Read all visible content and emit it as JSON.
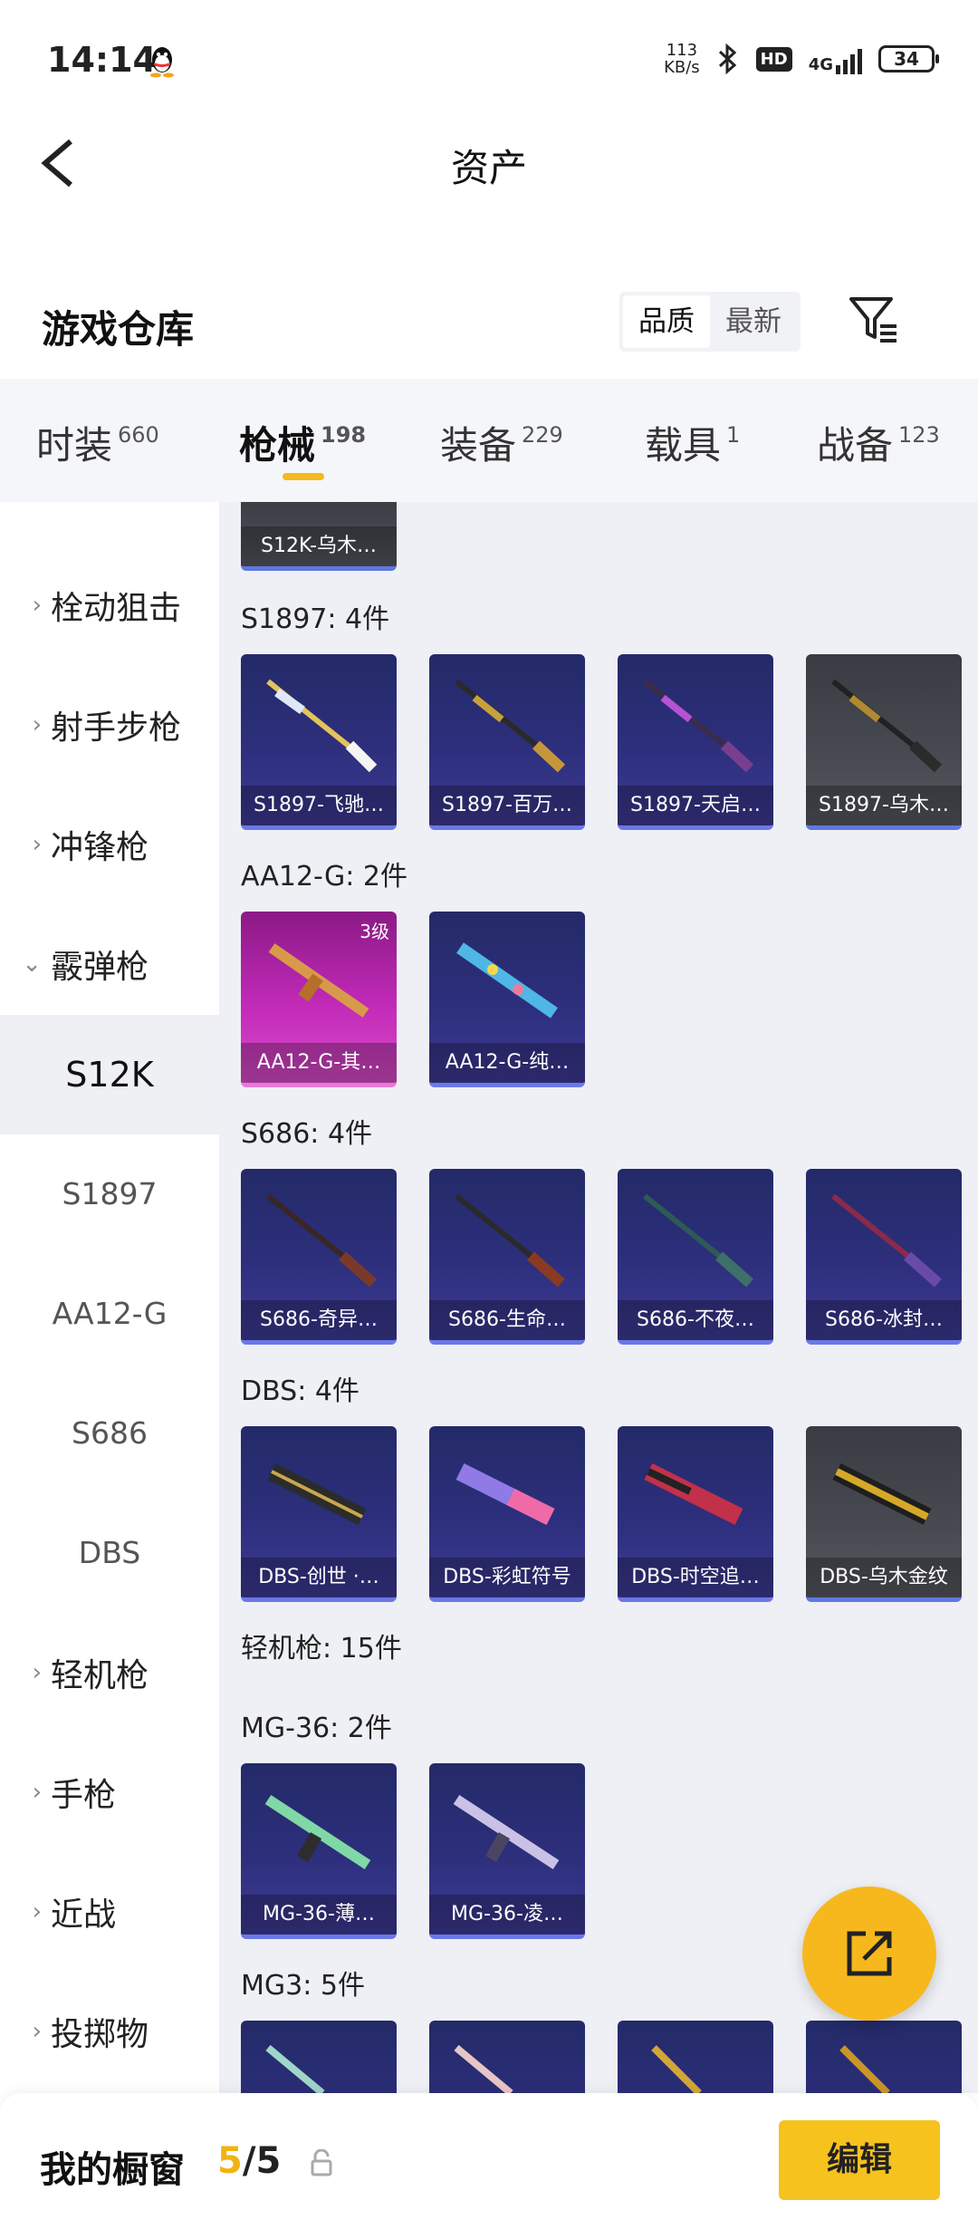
{
  "status": {
    "time": "14:14",
    "net_speed_value": "113",
    "net_speed_unit": "KB/s",
    "hd": "HD",
    "network": "4G",
    "battery": "34"
  },
  "header": {
    "title": "资产"
  },
  "warehouse": {
    "title": "游戏仓库",
    "sort_options": [
      "品质",
      "最新"
    ],
    "sort_active": "品质"
  },
  "tabs": [
    {
      "label": "时装",
      "count": "660"
    },
    {
      "label": "枪械",
      "count": "198"
    },
    {
      "label": "装备",
      "count": "229"
    },
    {
      "label": "载具",
      "count": "1"
    },
    {
      "label": "战备",
      "count": "123"
    }
  ],
  "sidebar": {
    "categories": [
      {
        "label": "栓动狙击",
        "expanded": false
      },
      {
        "label": "射手步枪",
        "expanded": false
      },
      {
        "label": "冲锋枪",
        "expanded": false
      },
      {
        "label": "霰弹枪",
        "expanded": true
      }
    ],
    "subitems": [
      "S12K",
      "S1897",
      "AA12-G",
      "S686",
      "DBS"
    ],
    "active_subitem": "S12K",
    "more_categories": [
      {
        "label": "轻机枪"
      },
      {
        "label": "手枪"
      },
      {
        "label": "近战"
      },
      {
        "label": "投掷物"
      }
    ]
  },
  "content": {
    "top_partial_card": {
      "label": "S12K-乌木…",
      "style": "grey"
    },
    "sections": [
      {
        "title": "S1897: 4件",
        "items": [
          {
            "label": "S1897-飞驰…",
            "style": "blue"
          },
          {
            "label": "S1897-百万…",
            "style": "blue"
          },
          {
            "label": "S1897-天启…",
            "style": "blue"
          },
          {
            "label": "S1897-乌木…",
            "style": "grey"
          }
        ]
      },
      {
        "title": "AA12-G: 2件",
        "items": [
          {
            "label": "AA12-G-其…",
            "style": "pink",
            "level": "3级"
          },
          {
            "label": "AA12-G-纯…",
            "style": "blue"
          }
        ]
      },
      {
        "title": "S686: 4件",
        "items": [
          {
            "label": "S686-奇异…",
            "style": "blue"
          },
          {
            "label": "S686-生命…",
            "style": "blue"
          },
          {
            "label": "S686-不夜…",
            "style": "blue"
          },
          {
            "label": "S686-冰封…",
            "style": "blue"
          }
        ]
      },
      {
        "title": "DBS: 4件",
        "items": [
          {
            "label": "DBS-创世 ·…",
            "style": "blue"
          },
          {
            "label": "DBS-彩虹符号",
            "style": "blue"
          },
          {
            "label": "DBS-时空追…",
            "style": "blue"
          },
          {
            "label": "DBS-乌木金纹",
            "style": "grey"
          }
        ]
      }
    ],
    "group_header": "轻机枪: 15件",
    "lmg_sections": [
      {
        "title": "MG-36: 2件",
        "items": [
          {
            "label": "MG-36-薄…",
            "style": "blue"
          },
          {
            "label": "MG-36-凌…",
            "style": "blue"
          }
        ]
      },
      {
        "title": "MG3: 5件"
      }
    ]
  },
  "showcase": {
    "title": "我的橱窗",
    "current": "5",
    "total": "/5",
    "edit_label": "编辑"
  }
}
